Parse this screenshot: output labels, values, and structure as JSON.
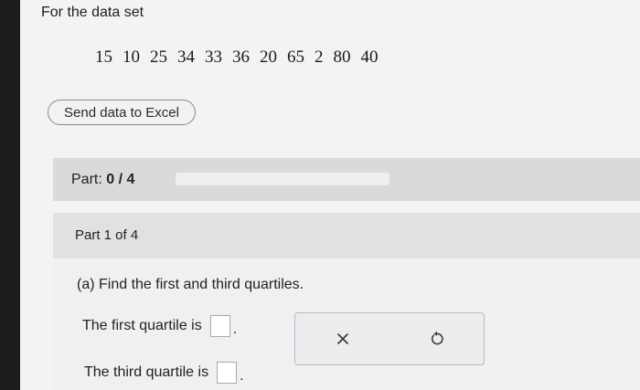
{
  "intro": "For the data set",
  "data_set": [
    "15",
    "10",
    "25",
    "34",
    "33",
    "36",
    "20",
    "65",
    "2",
    "80",
    "40"
  ],
  "excel_button": "Send data to Excel",
  "part_progress": {
    "label_prefix": "Part:",
    "value": "0 / 4",
    "fraction": 0
  },
  "part_title": "Part 1 of 4",
  "question": "(a) Find the first and third quartiles.",
  "answers": {
    "first_label": "The first quartile is",
    "third_label": "The third quartile is",
    "suffix": "."
  },
  "icons": {
    "clear": "close-icon",
    "reset": "undo-icon"
  },
  "colors": {
    "progress_fill": "#6aa0d8"
  }
}
